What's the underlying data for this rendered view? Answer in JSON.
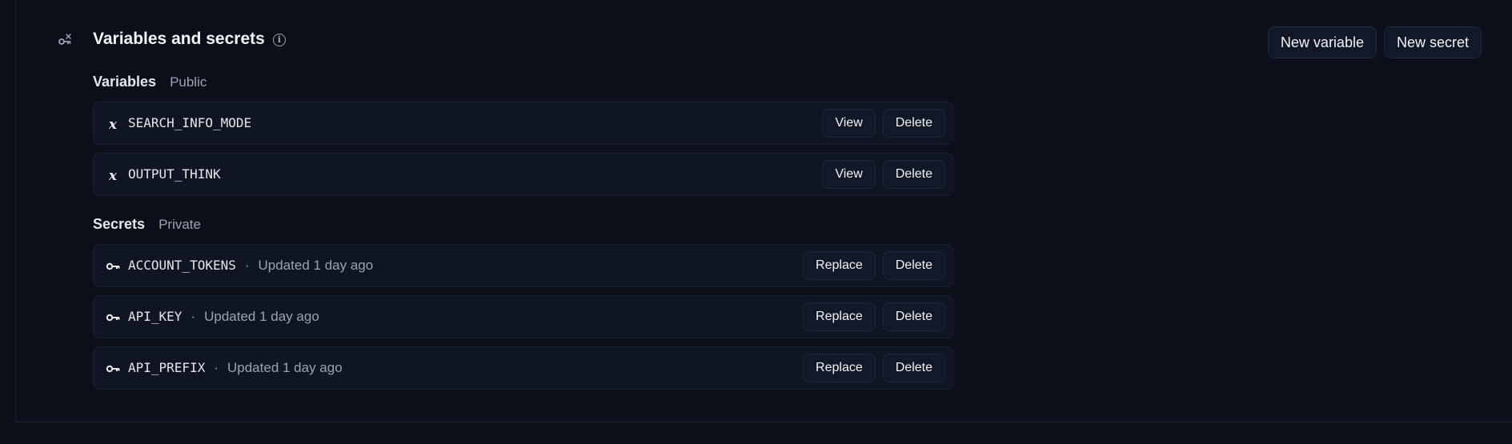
{
  "section": {
    "title": "Variables and secrets",
    "icon": "key-link-icon",
    "info_icon": "info-icon",
    "info_glyph": "i"
  },
  "actions": {
    "new_variable": "New variable",
    "new_secret": "New secret"
  },
  "variables": {
    "title": "Variables",
    "subtitle": "Public",
    "items": [
      {
        "name": "SEARCH_INFO_MODE",
        "view": "View",
        "delete": "Delete"
      },
      {
        "name": "OUTPUT_THINK",
        "view": "View",
        "delete": "Delete"
      }
    ]
  },
  "secrets": {
    "title": "Secrets",
    "subtitle": "Private",
    "separator": "·",
    "items": [
      {
        "name": "ACCOUNT_TOKENS",
        "updated": "Updated 1 day ago",
        "replace": "Replace",
        "delete": "Delete"
      },
      {
        "name": "API_KEY",
        "updated": "Updated 1 day ago",
        "replace": "Replace",
        "delete": "Delete"
      },
      {
        "name": "API_PREFIX",
        "updated": "Updated 1 day ago",
        "replace": "Replace",
        "delete": "Delete"
      }
    ]
  },
  "colors": {
    "background": "#0b0f19",
    "row_background": "#0f1522",
    "text_primary": "#e5e7eb",
    "text_secondary": "#9ca3af"
  }
}
